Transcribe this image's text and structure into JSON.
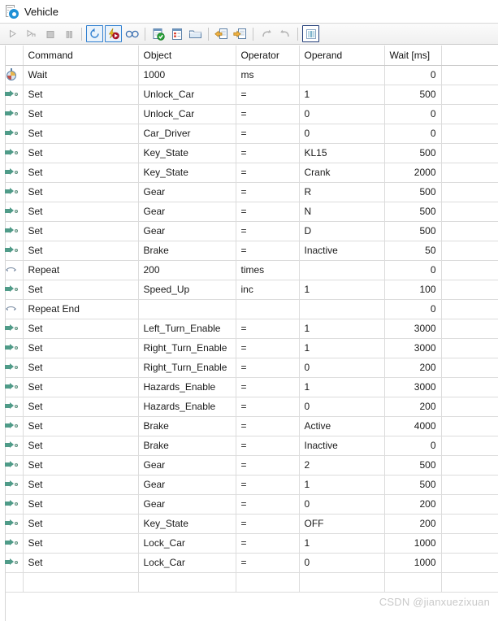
{
  "window": {
    "title": "Vehicle",
    "icon": "document-gear-icon"
  },
  "toolbar": {
    "buttons": [
      {
        "name": "play-button",
        "glyph": "play",
        "state": "disabled"
      },
      {
        "name": "step-button",
        "glyph": "step",
        "state": "disabled"
      },
      {
        "name": "stop-button",
        "glyph": "stop",
        "state": "disabled"
      },
      {
        "name": "pause-button",
        "glyph": "pause",
        "state": "disabled"
      },
      {
        "name": "separator-1",
        "glyph": "sep",
        "state": "none"
      },
      {
        "name": "restart-cycle-button",
        "glyph": "cycle",
        "state": "selected"
      },
      {
        "name": "fast-run-button",
        "glyph": "fastrun",
        "state": "selected"
      },
      {
        "name": "infinite-loop-button",
        "glyph": "infinity",
        "state": "normal"
      },
      {
        "name": "separator-2",
        "glyph": "sep",
        "state": "none"
      },
      {
        "name": "validate-button",
        "glyph": "validate",
        "state": "normal"
      },
      {
        "name": "new-sequence-button",
        "glyph": "newseq",
        "state": "normal"
      },
      {
        "name": "open-folder-button",
        "glyph": "folder",
        "state": "normal"
      },
      {
        "name": "separator-3",
        "glyph": "sep",
        "state": "none"
      },
      {
        "name": "import-button",
        "glyph": "import",
        "state": "normal"
      },
      {
        "name": "export-button",
        "glyph": "export",
        "state": "normal"
      },
      {
        "name": "separator-4",
        "glyph": "sep",
        "state": "none"
      },
      {
        "name": "undo-button",
        "glyph": "undo",
        "state": "disabled"
      },
      {
        "name": "redo-button",
        "glyph": "redo",
        "state": "disabled"
      },
      {
        "name": "separator-5",
        "glyph": "sep",
        "state": "none"
      },
      {
        "name": "columns-button",
        "glyph": "columns",
        "state": "selected-dark"
      }
    ]
  },
  "table": {
    "columns": [
      "",
      "Command",
      "Object",
      "Operator",
      "Operand",
      "Wait [ms]",
      ""
    ],
    "rows": [
      {
        "icon": "wait-icon",
        "command": "Wait",
        "object": "1000",
        "operator": "ms",
        "operand": "",
        "wait": "0",
        "indent": false
      },
      {
        "icon": "set-icon",
        "command": "Set",
        "object": "Unlock_Car",
        "operator": "=",
        "operand": "1",
        "wait": "500",
        "indent": false
      },
      {
        "icon": "set-icon",
        "command": "Set",
        "object": "Unlock_Car",
        "operator": "=",
        "operand": "0",
        "wait": "0",
        "indent": false
      },
      {
        "icon": "set-icon",
        "command": "Set",
        "object": "Car_Driver",
        "operator": "=",
        "operand": "0",
        "wait": "0",
        "indent": false
      },
      {
        "icon": "set-icon",
        "command": "Set",
        "object": "Key_State",
        "operator": "=",
        "operand": "KL15",
        "wait": "500",
        "indent": false
      },
      {
        "icon": "set-icon",
        "command": "Set",
        "object": "Key_State",
        "operator": "=",
        "operand": "Crank",
        "wait": "2000",
        "indent": false
      },
      {
        "icon": "set-icon",
        "command": "Set",
        "object": "Gear",
        "operator": "=",
        "operand": "R",
        "wait": "500",
        "indent": false
      },
      {
        "icon": "set-icon",
        "command": "Set",
        "object": "Gear",
        "operator": "=",
        "operand": "N",
        "wait": "500",
        "indent": false
      },
      {
        "icon": "set-icon",
        "command": "Set",
        "object": "Gear",
        "operator": "=",
        "operand": "D",
        "wait": "500",
        "indent": false
      },
      {
        "icon": "set-icon",
        "command": "Set",
        "object": "Brake",
        "operator": "=",
        "operand": "Inactive",
        "wait": "50",
        "indent": false
      },
      {
        "icon": "loop-icon",
        "command": "Repeat",
        "object": "200",
        "operator": "times",
        "operand": "",
        "wait": "0",
        "indent": false
      },
      {
        "icon": "set-icon",
        "command": "Set",
        "object": "Speed_Up",
        "operator": "inc",
        "operand": "1",
        "wait": "100",
        "indent": true
      },
      {
        "icon": "loop-icon",
        "command": "Repeat End",
        "object": "",
        "operator": "",
        "operand": "",
        "wait": "0",
        "indent": false
      },
      {
        "icon": "set-icon",
        "command": "Set",
        "object": "Left_Turn_Enable",
        "operator": "=",
        "operand": "1",
        "wait": "3000",
        "indent": false
      },
      {
        "icon": "set-icon",
        "command": "Set",
        "object": "Right_Turn_Enable",
        "operator": "=",
        "operand": "1",
        "wait": "3000",
        "indent": false
      },
      {
        "icon": "set-icon",
        "command": "Set",
        "object": "Right_Turn_Enable",
        "operator": "=",
        "operand": "0",
        "wait": "200",
        "indent": false
      },
      {
        "icon": "set-icon",
        "command": "Set",
        "object": "Hazards_Enable",
        "operator": "=",
        "operand": "1",
        "wait": "3000",
        "indent": false
      },
      {
        "icon": "set-icon",
        "command": "Set",
        "object": "Hazards_Enable",
        "operator": "=",
        "operand": "0",
        "wait": "200",
        "indent": false
      },
      {
        "icon": "set-icon",
        "command": "Set",
        "object": "Brake",
        "operator": "=",
        "operand": "Active",
        "wait": "4000",
        "indent": false
      },
      {
        "icon": "set-icon",
        "command": "Set",
        "object": "Brake",
        "operator": "=",
        "operand": "Inactive",
        "wait": "0",
        "indent": false
      },
      {
        "icon": "set-icon",
        "command": "Set",
        "object": "Gear",
        "operator": "=",
        "operand": "2",
        "wait": "500",
        "indent": false
      },
      {
        "icon": "set-icon",
        "command": "Set",
        "object": "Gear",
        "operator": "=",
        "operand": "1",
        "wait": "500",
        "indent": false
      },
      {
        "icon": "set-icon",
        "command": "Set",
        "object": "Gear",
        "operator": "=",
        "operand": "0",
        "wait": "200",
        "indent": false
      },
      {
        "icon": "set-icon",
        "command": "Set",
        "object": "Key_State",
        "operator": "=",
        "operand": "OFF",
        "wait": "200",
        "indent": false
      },
      {
        "icon": "set-icon",
        "command": "Set",
        "object": "Lock_Car",
        "operator": "=",
        "operand": "1",
        "wait": "1000",
        "indent": false
      },
      {
        "icon": "set-icon",
        "command": "Set",
        "object": "Lock_Car",
        "operator": "=",
        "operand": "0",
        "wait": "1000",
        "indent": false
      },
      {
        "icon": "",
        "command": "",
        "object": "",
        "operator": "",
        "operand": "",
        "wait": "",
        "indent": false
      }
    ]
  },
  "watermark": {
    "text": "CSDN @jianxuezixuan"
  },
  "colors": {
    "accent": "#2f7fd0",
    "set_icon": "#4f9b88",
    "loop_icon": "#6b7f99",
    "grid_line": "#dcdcdc",
    "watermark": "#c9c9c9"
  }
}
